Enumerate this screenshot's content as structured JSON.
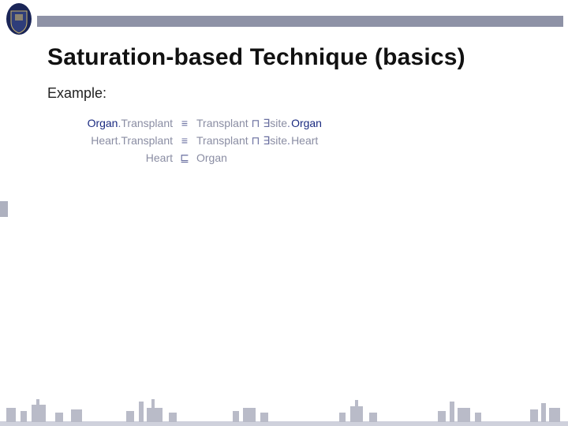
{
  "header": {
    "institution": "University crest",
    "stripe_color": "#8e92a6"
  },
  "slide": {
    "title": "Saturation-based Technique (basics)",
    "example_label": "Example:"
  },
  "axioms": [
    {
      "lhs_blue": "Organ",
      "lhs_grey": "Transplant",
      "relation": "≡",
      "rhs_class": "Transplant",
      "rhs_conj": "⊓",
      "rhs_quant": "∃",
      "rhs_role": "site",
      "rhs_filler": "Organ"
    },
    {
      "lhs_blue": "",
      "lhs_grey": "Heart.Transplant",
      "relation": "≡",
      "rhs_class": "Transplant",
      "rhs_conj": "⊓",
      "rhs_quant": "∃",
      "rhs_role": "site",
      "rhs_filler": "Heart"
    },
    {
      "lhs_blue": "",
      "lhs_grey": "Heart",
      "relation": "⊑",
      "rhs_class": "Organ",
      "rhs_conj": "",
      "rhs_quant": "",
      "rhs_role": "",
      "rhs_filler": ""
    }
  ],
  "colors": {
    "navy": "#1a2a80",
    "grey": "#8a8da3",
    "operator": "#6a6fa0",
    "header_stripe": "#8e92a6",
    "footer_silhouette": "#b9bbc8"
  }
}
